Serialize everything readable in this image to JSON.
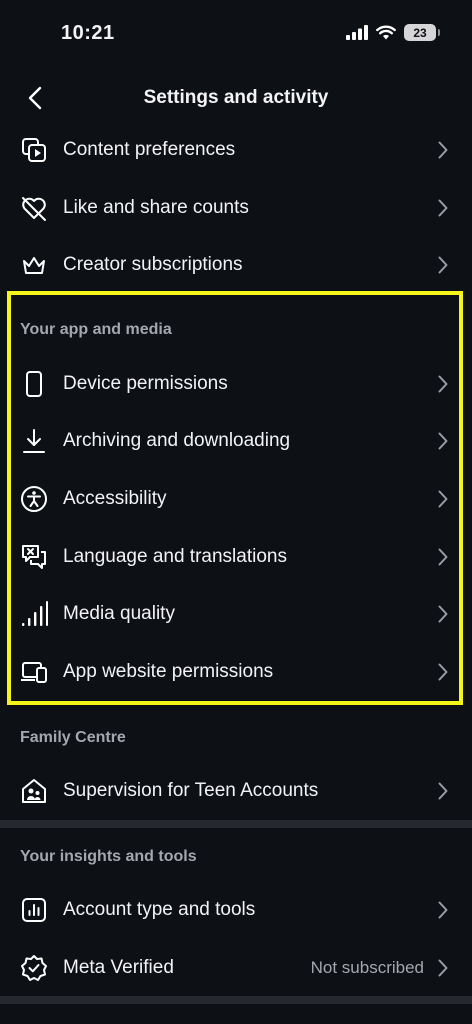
{
  "status_bar": {
    "time": "10:21",
    "battery": "23"
  },
  "header": {
    "title": "Settings and activity"
  },
  "rows_top": [
    {
      "label": "Content preferences",
      "icon": "content-preferences-icon"
    },
    {
      "label": "Like and share counts",
      "icon": "heart-crossed-icon"
    },
    {
      "label": "Creator subscriptions",
      "icon": "crown-icon"
    }
  ],
  "section_app_media": {
    "title": "Your app and media",
    "items": [
      {
        "label": "Device permissions",
        "icon": "phone-icon"
      },
      {
        "label": "Archiving and downloading",
        "icon": "download-icon"
      },
      {
        "label": "Accessibility",
        "icon": "accessibility-icon"
      },
      {
        "label": "Language and translations",
        "icon": "language-icon"
      },
      {
        "label": "Media quality",
        "icon": "signal-bars-icon"
      },
      {
        "label": "App website permissions",
        "icon": "devices-icon"
      }
    ]
  },
  "section_family": {
    "title": "Family Centre",
    "items": [
      {
        "label": "Supervision for Teen Accounts",
        "icon": "home-people-icon"
      }
    ]
  },
  "section_insights": {
    "title": "Your insights and tools",
    "items": [
      {
        "label": "Account type and tools",
        "icon": "chart-icon"
      },
      {
        "label": "Meta Verified",
        "icon": "verified-badge-icon",
        "value": "Not subscribed"
      }
    ]
  },
  "colors": {
    "highlight": "#f5f51a",
    "background": "#0d1015",
    "divider": "#262a30"
  }
}
